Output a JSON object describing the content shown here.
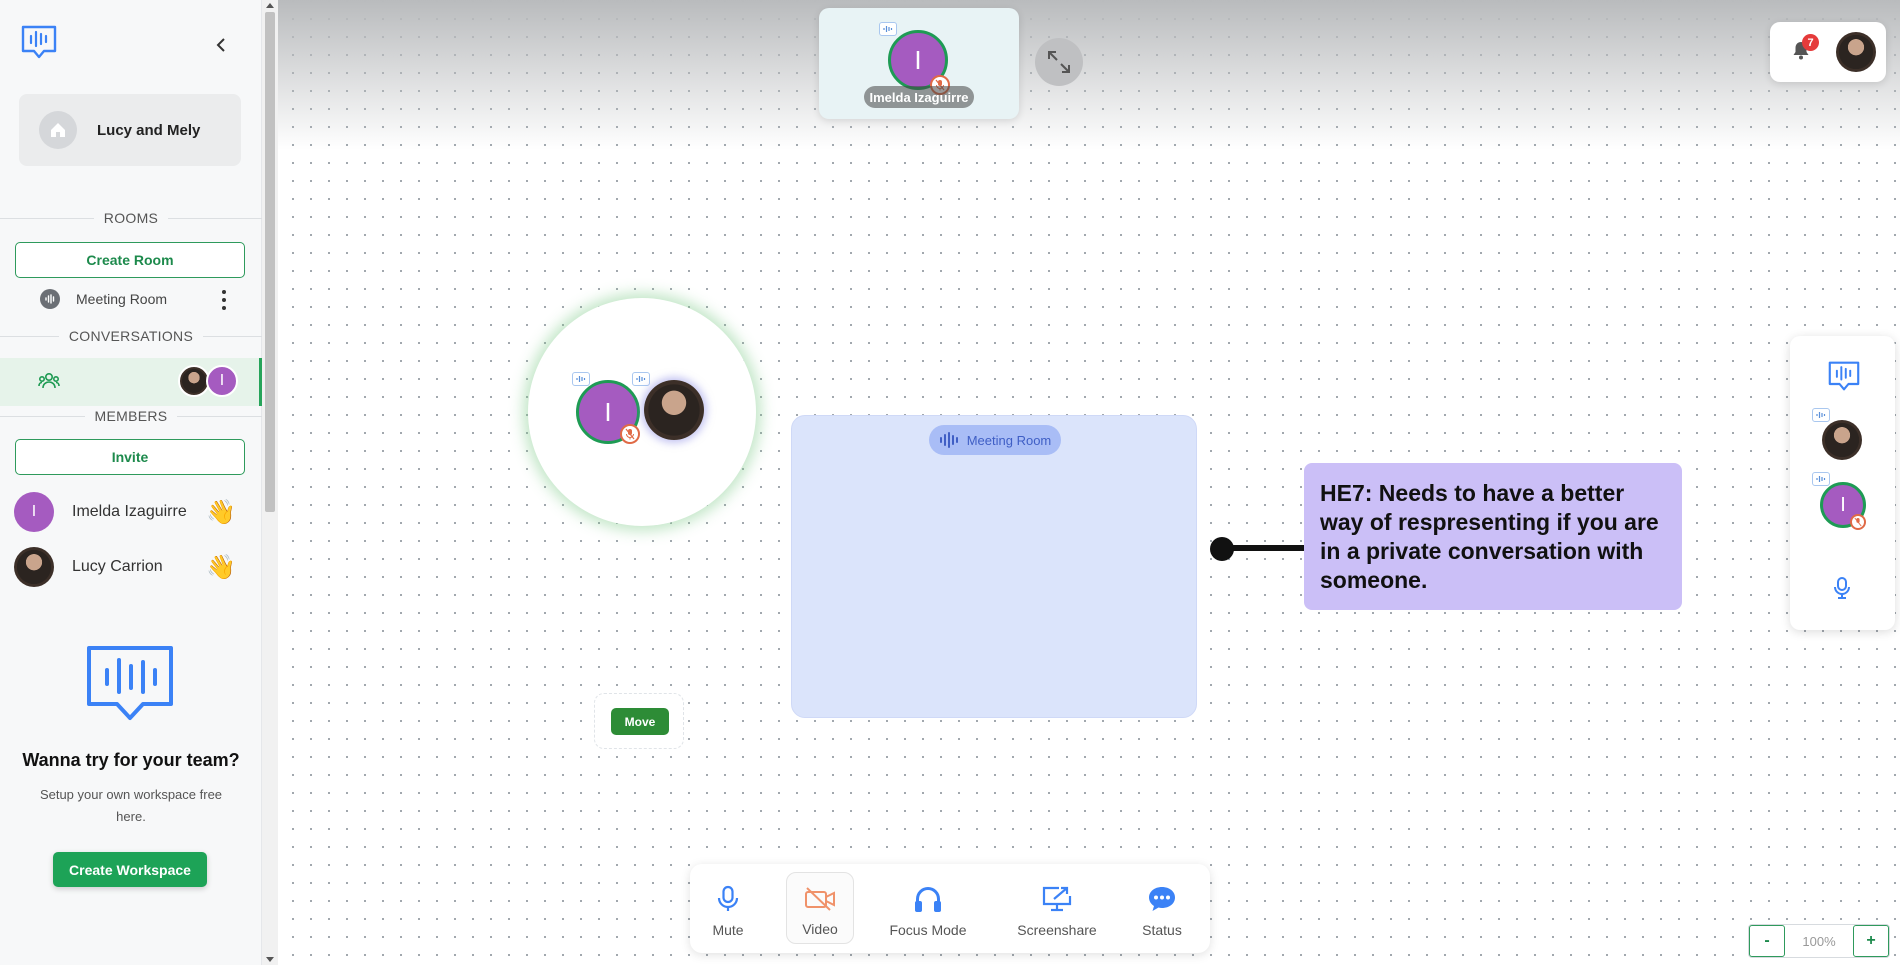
{
  "workspace": {
    "name": "Lucy and Mely"
  },
  "sidebar": {
    "rooms_label": "ROOMS",
    "create_room": "Create Room",
    "rooms": [
      {
        "name": "Meeting Room"
      }
    ],
    "conversations_label": "CONVERSATIONS",
    "members_label": "MEMBERS",
    "invite": "Invite",
    "members": [
      {
        "name": "Imelda Izaguirre",
        "initial": "I",
        "wave": "👋"
      },
      {
        "name": "Lucy Carrion",
        "initial": "",
        "wave": "👋"
      }
    ],
    "promo": {
      "title": "Wanna try for your team?",
      "subtitle": "Setup your own workspace free here.",
      "button": "Create Workspace"
    }
  },
  "speaker": {
    "name": "Imelda Izaguirre",
    "initial": "I"
  },
  "notifications": {
    "count": "7"
  },
  "bubble": {
    "initial": "I"
  },
  "room_on_canvas": {
    "name": "Meeting Room"
  },
  "move_label": "Move",
  "note": {
    "text": "HE7: Needs to have a better way of respresenting if you are in a private conversation with someone."
  },
  "right_panel": {
    "initial": "I"
  },
  "toolbar": {
    "mute": "Mute",
    "video": "Video",
    "focus": "Focus Mode",
    "screenshare": "Screenshare",
    "status": "Status"
  },
  "zoom": {
    "minus": "-",
    "value": "100%",
    "plus": "+"
  },
  "colors": {
    "accent_green": "#1da357",
    "avatar_purple": "#a55bc0",
    "brand_blue": "#3b82f6",
    "note_bg": "#cbbff7",
    "video_off": "#f0926a"
  }
}
